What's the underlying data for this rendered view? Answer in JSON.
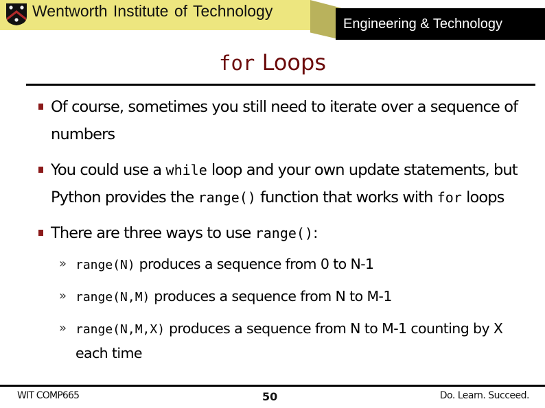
{
  "header": {
    "institution": "Wentworth Institute of Technology",
    "department": "Engineering & Technology",
    "logo_icon": "wit-shield-logo",
    "colors": {
      "banner": "#ede67f",
      "fold": "#b9b25c",
      "dept_bg": "#000000",
      "title": "#6b0a0a",
      "bullet": "#8b1a1a"
    }
  },
  "slide": {
    "title_code": "for",
    "title_text": " Loops",
    "bullets": [
      {
        "parts": [
          "Of course, sometimes you still need to iterate over a sequence of numbers"
        ]
      },
      {
        "parts": [
          "You could use a ",
          "while",
          " loop and your own update statements, but Python provides the ",
          "range()",
          " function that works with ",
          "for",
          " loops"
        ]
      },
      {
        "parts": [
          "There are three ways to use ",
          "range()",
          ":"
        ]
      }
    ],
    "sub_bullets": [
      {
        "code": "range(N)",
        "text": " produces a sequence from 0 to N-1"
      },
      {
        "code": "range(N,M)",
        "text": " produces a sequence from N to M-1"
      },
      {
        "code": "range(N,M,X)",
        "text": " produces a sequence from N to M-1 counting by X each time"
      }
    ]
  },
  "footer": {
    "course": "WIT COMP665",
    "page_number": "50",
    "slogan": "Do. Learn. Succeed."
  }
}
